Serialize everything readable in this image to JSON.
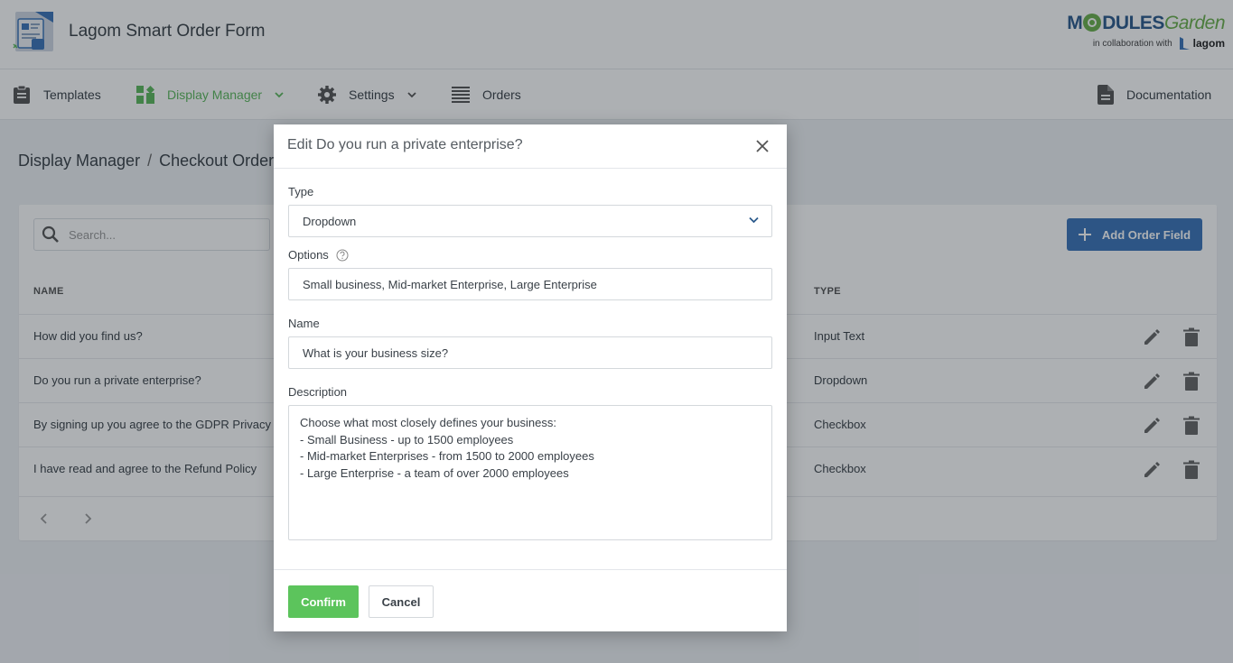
{
  "header": {
    "app_title": "Lagom Smart Order Form",
    "brand_modules": "M",
    "brand_modules_rest": "DULES",
    "brand_garden": "Garden",
    "brand_collab": "in collaboration with",
    "brand_partner": "lagom"
  },
  "nav": {
    "templates": "Templates",
    "display_manager": "Display Manager",
    "settings": "Settings",
    "orders": "Orders",
    "documentation": "Documentation",
    "active_color": "#5cb85c"
  },
  "breadcrumb": {
    "parent": "Display Manager",
    "separator": "/",
    "current": "Checkout Order"
  },
  "list": {
    "search_placeholder": "Search...",
    "add_button": "Add Order Field",
    "col_name": "NAME",
    "col_type": "TYPE",
    "rows": [
      {
        "name": "How did you find us?",
        "type": "Input Text"
      },
      {
        "name": "Do you run a private enterprise?",
        "type": "Dropdown"
      },
      {
        "name": "By signing up you agree to the GDPR Privacy Notice",
        "type": "Checkbox"
      },
      {
        "name": "I have read and agree to the Refund Policy",
        "type": "Checkbox"
      }
    ]
  },
  "modal": {
    "title": "Edit Do you run a private enterprise?",
    "type_label": "Type",
    "type_value": "Dropdown",
    "options_label": "Options",
    "options_value": "Small business, Mid-market Enterprise, Large Enterprise",
    "name_label": "Name",
    "name_value": "What is your business size?",
    "description_label": "Description",
    "description_value": "Choose what most closely defines your business:\n- Small Business - up to 1500 employees\n- Mid-market Enterprises - from 1500 to 2000 employees\n- Large Enterprise - a team of over 2000 employees",
    "confirm": "Confirm",
    "cancel": "Cancel",
    "confirm_color": "#5cc45c"
  }
}
